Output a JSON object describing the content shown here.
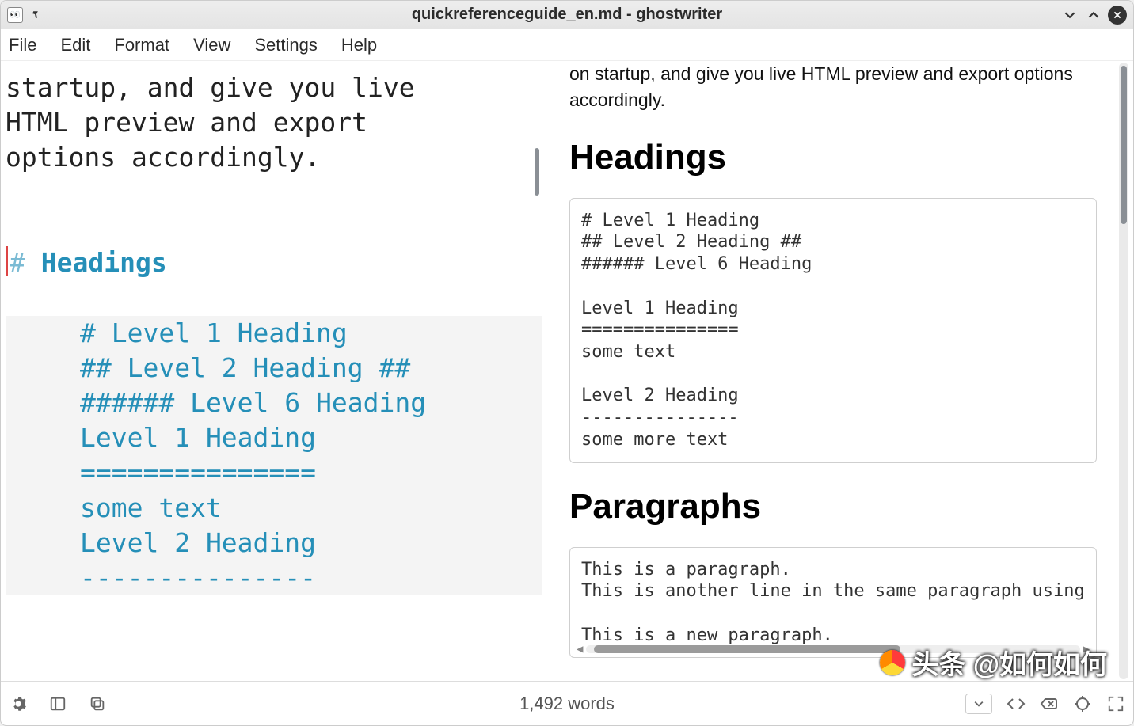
{
  "window": {
    "title": "quickreferenceguide_en.md - ghostwriter"
  },
  "menu": {
    "file": "File",
    "edit": "Edit",
    "format": "Format",
    "view": "View",
    "settings": "Settings",
    "help": "Help"
  },
  "editor": {
    "intro_line1": "startup, and give you live",
    "intro_line2": "HTML preview and export",
    "intro_line3": "options accordingly.",
    "heading_marker": "#",
    "heading_text": " Headings",
    "code_line1": "# Level 1 Heading",
    "code_line2": "## Level 2 Heading ##",
    "code_line3": "###### Level 6 Heading",
    "code_line4": "",
    "code_line5": "Level 1 Heading",
    "code_line6": "===============",
    "code_line7": "some text",
    "code_line8": "",
    "code_line9": "Level 2 Heading",
    "code_line10": "---------------"
  },
  "preview": {
    "intro": "on startup, and give you live HTML preview and export options accordingly.",
    "h1a": "Headings",
    "code1": "# Level 1 Heading\n## Level 2 Heading ##\n###### Level 6 Heading\n\nLevel 1 Heading\n===============\nsome text\n\nLevel 2 Heading\n---------------\nsome more text",
    "h1b": "Paragraphs",
    "code2": "This is a paragraph.\nThis is another line in the same paragraph using\n\nThis is a new paragraph."
  },
  "status": {
    "words": "1,492 words"
  },
  "watermark": {
    "text": "头条 @如何如何"
  }
}
